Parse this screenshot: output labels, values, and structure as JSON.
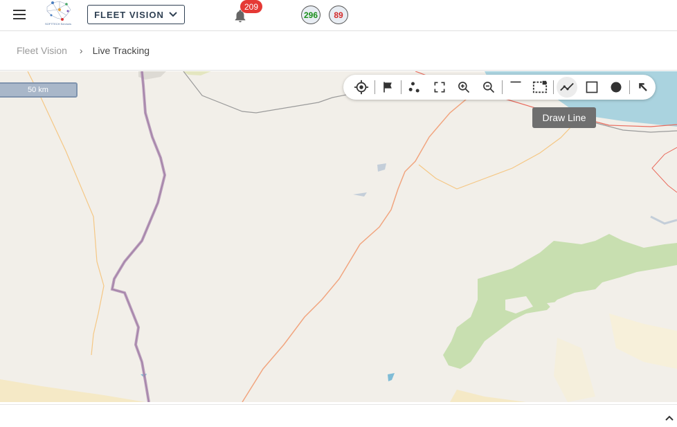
{
  "header": {
    "logo_icon": "company-logo",
    "logo_caption": "SOFTTECH Services",
    "fleet_selector": {
      "label": "FLEET VISION",
      "icon": "chevron-down-icon"
    },
    "notifications": {
      "icon": "bell-icon",
      "count": "209"
    },
    "status_counts": [
      {
        "value": "296",
        "color": "#1a8f1a"
      },
      {
        "value": "89",
        "color": "#d42a2a"
      }
    ]
  },
  "breadcrumb": {
    "root": "Fleet Vision",
    "separator": "›",
    "current": "Live Tracking"
  },
  "map": {
    "scale_label": "50 km",
    "toolbar": [
      {
        "name": "locate-icon",
        "title": "Locate"
      },
      {
        "name": "flag-icon",
        "title": "Flag"
      },
      {
        "name": "cluster-icon",
        "title": "Cluster"
      },
      {
        "name": "fullscreen-icon",
        "title": "Fullscreen"
      },
      {
        "name": "zoom-in-icon",
        "title": "Zoom In"
      },
      {
        "name": "zoom-out-icon",
        "title": "Zoom Out"
      },
      {
        "name": "minimize-icon",
        "title": "Minimize"
      },
      {
        "name": "select-area-icon",
        "title": "Select Area"
      },
      {
        "name": "draw-line-icon",
        "title": "Draw Line",
        "active": true
      },
      {
        "name": "draw-rectangle-icon",
        "title": "Draw Rectangle"
      },
      {
        "name": "draw-circle-icon",
        "title": "Draw Circle"
      },
      {
        "name": "arrow-up-left-icon",
        "title": "Clear"
      }
    ],
    "tooltip": "Draw Line",
    "colors": {
      "land": "#f2efe9",
      "water": "#aad3df",
      "forest": "#c8dfb0",
      "road": "#f1a57f",
      "border": "#b08fb3"
    }
  },
  "bottom_panel": {
    "toggle_icon": "chevron-up-icon"
  }
}
